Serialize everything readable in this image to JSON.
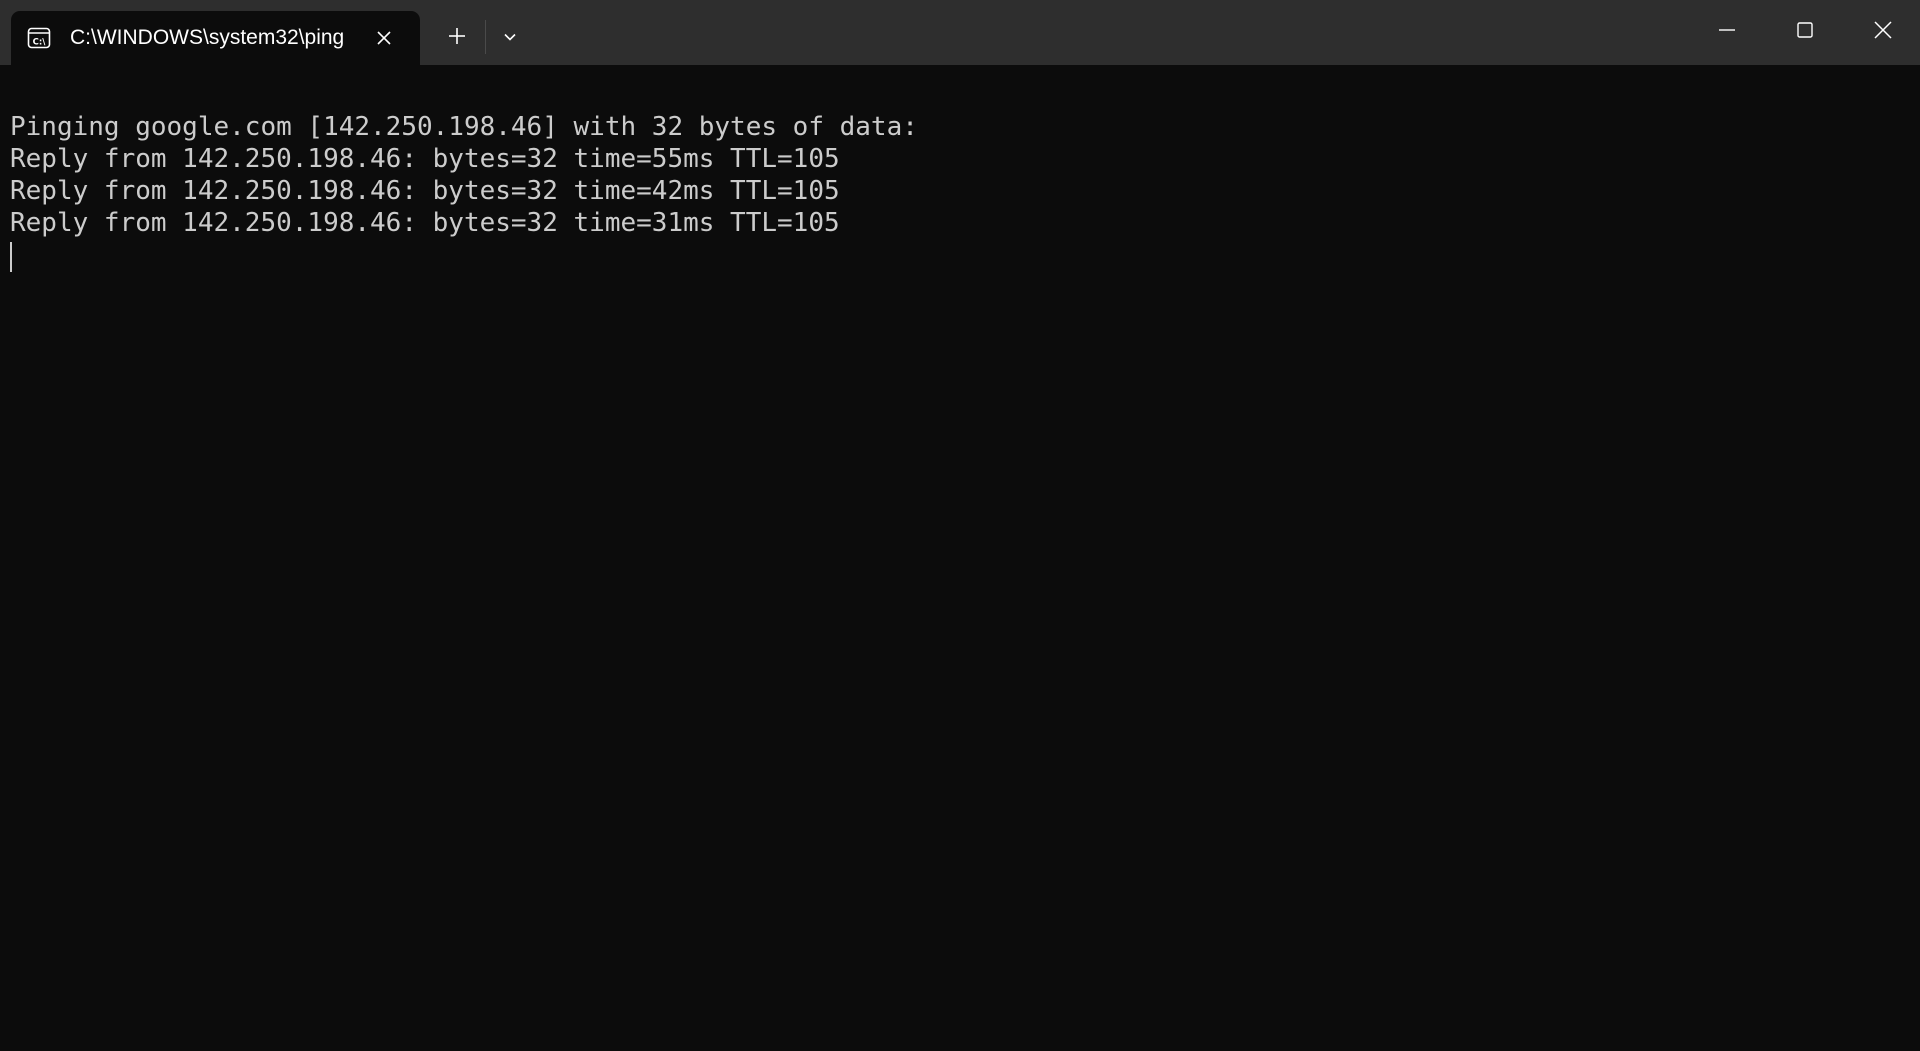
{
  "window": {
    "tab": {
      "title": "C:\\WINDOWS\\system32\\ping",
      "icon": "command-prompt-icon"
    },
    "controls": {
      "new_tab_icon": "plus-icon",
      "dropdown_icon": "chevron-down-icon",
      "minimize_icon": "minimize-icon",
      "maximize_icon": "maximize-icon",
      "close_icon": "close-icon"
    }
  },
  "terminal": {
    "lines": [
      "Pinging google.com [142.250.198.46] with 32 bytes of data:",
      "Reply from 142.250.198.46: bytes=32 time=55ms TTL=105",
      "Reply from 142.250.198.46: bytes=32 time=42ms TTL=105",
      "Reply from 142.250.198.46: bytes=32 time=31ms TTL=105"
    ]
  },
  "colors": {
    "titlebar": "#2e2e2e",
    "background": "#0c0c0c",
    "text": "#cccccc"
  }
}
